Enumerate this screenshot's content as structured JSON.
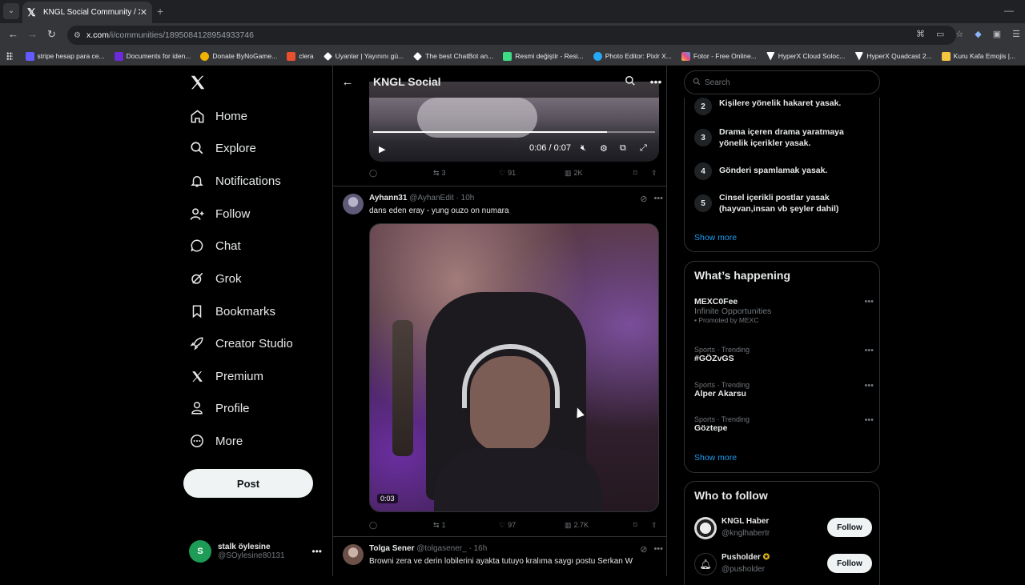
{
  "browser": {
    "tab_title": "KNGL Social Community / X",
    "url_host": "x.com",
    "url_path": "/i/communities/1895084128954933746",
    "bookmarks": [
      {
        "label": "stripe hesap para ce...",
        "color": "#635bff"
      },
      {
        "label": "Documents for iden...",
        "color": "#6c2bd9"
      },
      {
        "label": "Donate ByNoGame...",
        "color": "#f0b400"
      },
      {
        "label": "clera",
        "color": "#e8502e"
      },
      {
        "label": "Uyanlar | Yayınını gü...",
        "color": "#ffffff"
      },
      {
        "label": "The best ChatBot an...",
        "color": "#ffffff"
      },
      {
        "label": "Resmi değiştir - Resi...",
        "color": "#3ddc84"
      },
      {
        "label": "Photo Editor: Pixlr X...",
        "color": "#27a7f5"
      },
      {
        "label": "Fotor - Free Online...",
        "color": "#f2c230"
      },
      {
        "label": "HyperX Cloud Soloc...",
        "color": "#ffffff"
      },
      {
        "label": "HyperX Quadcast 2...",
        "color": "#ffffff"
      },
      {
        "label": "Kuru Kafa Emojis |...",
        "color": "#f5c542"
      }
    ]
  },
  "nav": {
    "items": [
      {
        "label": "Home",
        "icon": "home-icon"
      },
      {
        "label": "Explore",
        "icon": "search-icon"
      },
      {
        "label": "Notifications",
        "icon": "bell-icon"
      },
      {
        "label": "Follow",
        "icon": "person-plus-icon"
      },
      {
        "label": "Chat",
        "icon": "chat-icon"
      },
      {
        "label": "Grok",
        "icon": "grok-icon"
      },
      {
        "label": "Bookmarks",
        "icon": "bookmark-icon"
      },
      {
        "label": "Creator Studio",
        "icon": "rocket-icon"
      },
      {
        "label": "Premium",
        "icon": "x-icon"
      },
      {
        "label": "Profile",
        "icon": "person-icon"
      },
      {
        "label": "More",
        "icon": "more-circle-icon"
      }
    ],
    "post_label": "Post",
    "account": {
      "initial": "S",
      "name": "stalk öylesine",
      "handle": "@SOylesine80131"
    }
  },
  "community": {
    "title": "KNGL Social",
    "tweet1": {
      "video_time": "0:06 / 0:07",
      "progress": 0.83,
      "replies": "",
      "retweets": "3",
      "likes": "91",
      "views": "2K"
    },
    "tweet2": {
      "name": "Ayhann31",
      "handle": "@AyhanEdit",
      "age": "· 10h",
      "text": "dans eden eray - yung ouzo on numara",
      "video_duration": "0:03",
      "replies": "",
      "retweets": "1",
      "likes": "97",
      "views": "2.7K"
    },
    "tweet3": {
      "name": "Tolga Sener",
      "handle": "@tolgasener_",
      "age": "· 16h",
      "text": "Browni zera ve derin lobilerini ayakta tutuyo kralıma saygı postu Serkan W"
    }
  },
  "sidebar": {
    "search_placeholder": "Search",
    "rules": [
      {
        "num": "2",
        "text": "Kişilere yönelik hakaret yasak."
      },
      {
        "num": "3",
        "text": "Drama içeren drama yaratmaya yönelik içerikler yasak."
      },
      {
        "num": "4",
        "text": "Gönderi spamlamak yasak."
      },
      {
        "num": "5",
        "text": "Cinsel içerikli postlar yasak (hayvan,insan vb şeyler dahil)"
      }
    ],
    "show_more": "Show more",
    "happening": {
      "title": "What’s happening",
      "trends": [
        {
          "meta": "",
          "title": "MEXC0Fee",
          "sub": "Infinite Opportunities",
          "promo": "Promoted by MEXC"
        },
        {
          "meta": "Sports · Trending",
          "title": "#GÖZvGS",
          "sub": "",
          "promo": ""
        },
        {
          "meta": "Sports · Trending",
          "title": "Alper Akarsu",
          "sub": "",
          "promo": ""
        },
        {
          "meta": "Sports · Trending",
          "title": "Göztepe",
          "sub": "",
          "promo": ""
        }
      ],
      "show_more": "Show more"
    },
    "who_to_follow": {
      "title": "Who to follow",
      "accounts": [
        {
          "name": "KNGL Haber",
          "handle": "@knglhabertr",
          "button": "Follow"
        },
        {
          "name": "Pusholder",
          "handle": "@pusholder",
          "button": "Follow"
        }
      ]
    }
  }
}
